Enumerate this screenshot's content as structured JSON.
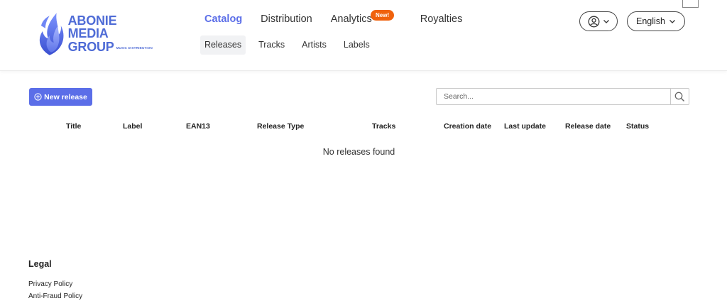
{
  "brand": {
    "line1": "ABONIE MEDIA",
    "line2": "GROUP",
    "tagline": "MUSIC DISTRIBUTION",
    "color": "#4e6bd6"
  },
  "nav": {
    "top": [
      {
        "label": "Catalog",
        "active": true
      },
      {
        "label": "Distribution",
        "active": false
      },
      {
        "label": "Analytics",
        "active": false
      },
      {
        "label": "Royalties",
        "active": false
      }
    ],
    "badge": "New!",
    "sub": [
      {
        "label": "Releases",
        "active": true
      },
      {
        "label": "Tracks",
        "active": false
      },
      {
        "label": "Artists",
        "active": false
      },
      {
        "label": "Labels",
        "active": false
      }
    ]
  },
  "header": {
    "user_icon": "user-circle-icon",
    "language": "English"
  },
  "toolbar": {
    "new_release_label": "New release",
    "search_placeholder": "Search..."
  },
  "table": {
    "columns": [
      "Title",
      "Label",
      "EAN13",
      "Release Type",
      "Tracks",
      "Creation date",
      "Last update",
      "Release date",
      "Status"
    ],
    "empty_message": "No releases found"
  },
  "footer": {
    "legal_title": "Legal",
    "links": [
      "Privacy Policy",
      "Anti-Fraud Policy"
    ]
  },
  "colors": {
    "accent": "#5b6ee8",
    "badge": "#f0620d"
  }
}
